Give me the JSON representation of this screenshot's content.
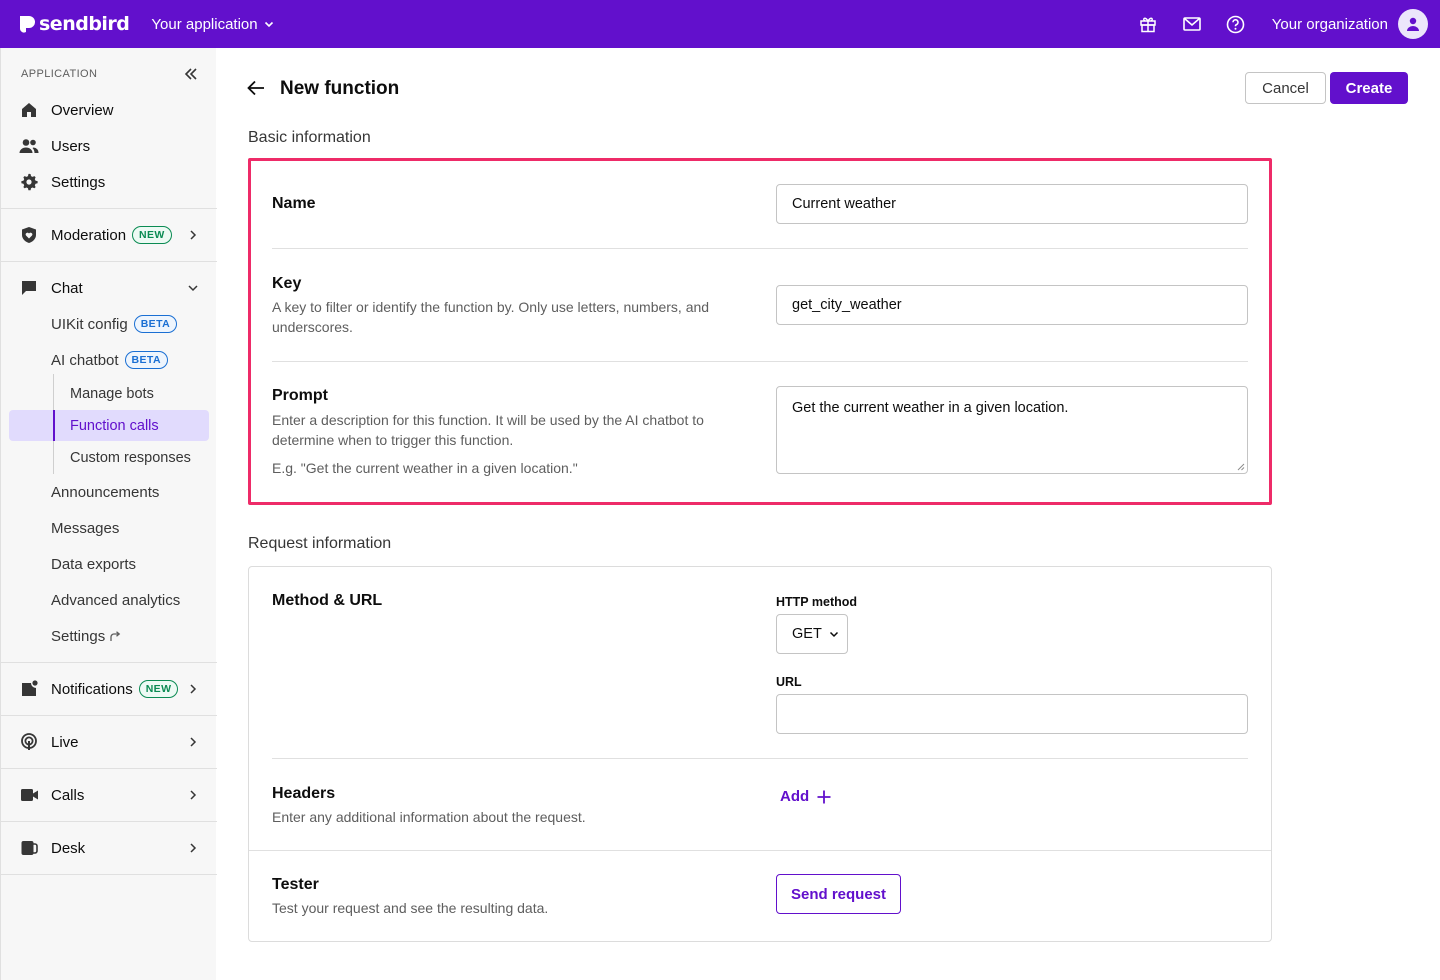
{
  "topbar": {
    "brand": "sendbird",
    "app_switcher": "Your application",
    "organization": "Your organization",
    "icons": [
      "gift-icon",
      "mail-icon",
      "help-icon",
      "user-avatar-icon"
    ],
    "color": "#6210cc"
  },
  "sidebar": {
    "section_label": "APPLICATION",
    "top_items": [
      {
        "label": "Overview",
        "icon": "home-icon"
      },
      {
        "label": "Users",
        "icon": "users-icon"
      },
      {
        "label": "Settings",
        "icon": "gear-icon"
      }
    ],
    "moderation": {
      "label": "Moderation",
      "badge": "NEW"
    },
    "chat": {
      "label": "Chat",
      "uikit": {
        "label": "UIKit config",
        "badge": "BETA"
      },
      "ai_chatbot": {
        "label": "AI chatbot",
        "badge": "BETA"
      },
      "ai_children": [
        "Manage bots",
        "Function calls",
        "Custom responses"
      ],
      "others": [
        "Announcements",
        "Messages",
        "Data exports",
        "Advanced analytics",
        "Settings"
      ]
    },
    "notifications": {
      "label": "Notifications",
      "badge": "NEW"
    },
    "live": {
      "label": "Live"
    },
    "calls": {
      "label": "Calls"
    },
    "desk": {
      "label": "Desk"
    },
    "active_item": "Function calls"
  },
  "page": {
    "title": "New function",
    "cancel_label": "Cancel",
    "create_label": "Create"
  },
  "basic": {
    "section_title": "Basic information",
    "name": {
      "label": "Name",
      "value": "Current weather"
    },
    "key": {
      "label": "Key",
      "description": "A key to filter or identify the function by. Only use letters, numbers, and underscores.",
      "value": "get_city_weather"
    },
    "prompt": {
      "label": "Prompt",
      "description": "Enter a description for this function. It will be used by the AI chatbot to determine when to trigger this function.",
      "example": "E.g. \"Get the current weather in a given location.\"",
      "value": "Get the current weather in a given location."
    }
  },
  "request": {
    "section_title": "Request information",
    "method_url": {
      "label": "Method & URL",
      "http_method_label": "HTTP method",
      "http_method_value": "GET",
      "url_label": "URL",
      "url_value": ""
    },
    "headers": {
      "label": "Headers",
      "description": "Enter any additional information about the request.",
      "add_label": "Add"
    },
    "tester": {
      "label": "Tester",
      "description": "Test your request and see the resulting data.",
      "send_label": "Send request"
    }
  }
}
